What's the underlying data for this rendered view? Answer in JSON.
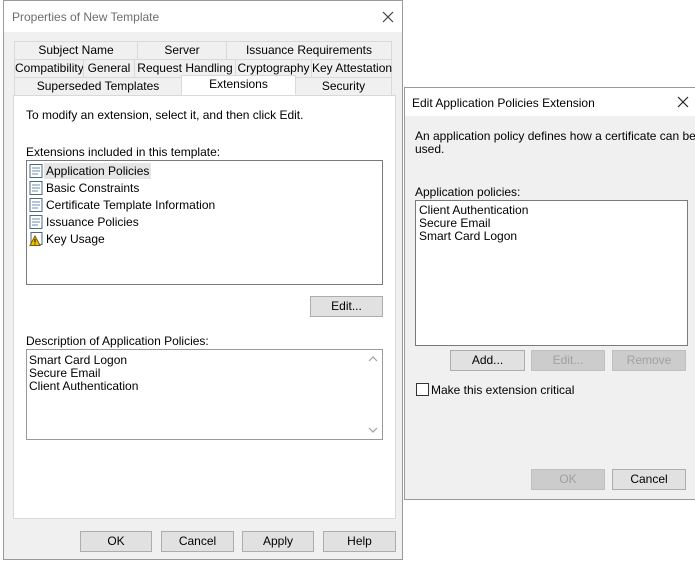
{
  "dialog1": {
    "title": "Properties of New Template",
    "tabs_row1": [
      "Subject Name",
      "Server",
      "Issuance Requirements"
    ],
    "tabs_row2": [
      "Compatibility",
      "General",
      "Request Handling",
      "Cryptography",
      "Key Attestation"
    ],
    "tabs_row3": [
      "Superseded Templates",
      "Extensions",
      "Security"
    ],
    "active_tab": "Extensions",
    "instruction": "To modify an extension, select it, and then click Edit.",
    "extensions_label": "Extensions included in this template:",
    "extensions": [
      {
        "label": "Application Policies",
        "icon": "certificate-icon",
        "selected": true
      },
      {
        "label": "Basic Constraints",
        "icon": "certificate-icon"
      },
      {
        "label": "Certificate Template Information",
        "icon": "certificate-icon"
      },
      {
        "label": "Issuance Policies",
        "icon": "certificate-icon"
      },
      {
        "label": "Key Usage",
        "icon": "warning-certificate-icon"
      }
    ],
    "edit_button": "Edit...",
    "description_label": "Description of Application Policies:",
    "description_lines": [
      "Smart Card Logon",
      "Secure Email",
      "Client Authentication"
    ],
    "buttons": {
      "ok": "OK",
      "cancel": "Cancel",
      "apply": "Apply",
      "help": "Help"
    }
  },
  "dialog2": {
    "title": "Edit Application Policies Extension",
    "description": [
      "An application policy defines how a certificate can be",
      "used."
    ],
    "policies_label": "Application policies:",
    "policies": [
      "Client Authentication",
      "Secure Email",
      "Smart Card Logon"
    ],
    "add_button": "Add...",
    "edit_button": "Edit...",
    "remove_button": "Remove",
    "critical_checkbox_label": "Make this extension critical",
    "critical_checked": false,
    "ok_button": "OK",
    "cancel_button": "Cancel"
  }
}
